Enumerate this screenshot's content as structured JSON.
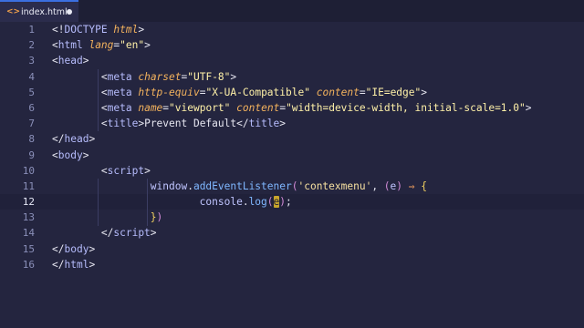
{
  "tab": {
    "filename": "index.html",
    "icon": "<>",
    "modified": true
  },
  "active_line": 12,
  "lines": [
    {
      "num": "1",
      "indent": "",
      "tokens": [
        [
          "t-punct",
          "<!"
        ],
        [
          "t-tag",
          "DOCTYPE"
        ],
        [
          "t-punct",
          " "
        ],
        [
          "t-attr",
          "html"
        ],
        [
          "t-punct",
          ">"
        ]
      ]
    },
    {
      "num": "2",
      "indent": "",
      "tokens": [
        [
          "t-punct",
          "<"
        ],
        [
          "t-tag",
          "html"
        ],
        [
          "t-punct",
          " "
        ],
        [
          "t-attr",
          "lang"
        ],
        [
          "t-punct",
          "="
        ],
        [
          "t-str",
          "\"en\""
        ],
        [
          "t-punct",
          ">"
        ]
      ]
    },
    {
      "num": "3",
      "indent": "",
      "tokens": [
        [
          "t-punct",
          "<"
        ],
        [
          "t-tag",
          "head"
        ],
        [
          "t-punct",
          ">"
        ]
      ]
    },
    {
      "num": "4",
      "indent": "        ",
      "tokens": [
        [
          "t-punct",
          "<"
        ],
        [
          "t-tag",
          "meta"
        ],
        [
          "t-punct",
          " "
        ],
        [
          "t-attr",
          "charset"
        ],
        [
          "t-punct",
          "="
        ],
        [
          "t-str",
          "\"UTF-8\""
        ],
        [
          "t-punct",
          ">"
        ]
      ]
    },
    {
      "num": "5",
      "indent": "        ",
      "tokens": [
        [
          "t-punct",
          "<"
        ],
        [
          "t-tag",
          "meta"
        ],
        [
          "t-punct",
          " "
        ],
        [
          "t-attr",
          "http-equiv"
        ],
        [
          "t-punct",
          "="
        ],
        [
          "t-str",
          "\"X-UA-Compatible\""
        ],
        [
          "t-punct",
          " "
        ],
        [
          "t-attr",
          "content"
        ],
        [
          "t-punct",
          "="
        ],
        [
          "t-str",
          "\"IE=edge\""
        ],
        [
          "t-punct",
          ">"
        ]
      ]
    },
    {
      "num": "6",
      "indent": "        ",
      "tokens": [
        [
          "t-punct",
          "<"
        ],
        [
          "t-tag",
          "meta"
        ],
        [
          "t-punct",
          " "
        ],
        [
          "t-attr",
          "name"
        ],
        [
          "t-punct",
          "="
        ],
        [
          "t-str",
          "\"viewport\""
        ],
        [
          "t-punct",
          " "
        ],
        [
          "t-attr",
          "content"
        ],
        [
          "t-punct",
          "="
        ],
        [
          "t-str",
          "\"width=device-width, initial-scale=1.0\""
        ],
        [
          "t-punct",
          ">"
        ]
      ]
    },
    {
      "num": "7",
      "indent": "        ",
      "tokens": [
        [
          "t-punct",
          "<"
        ],
        [
          "t-tag",
          "title"
        ],
        [
          "t-punct",
          ">"
        ],
        [
          "t-plain",
          "Prevent Default"
        ],
        [
          "t-punct",
          "</"
        ],
        [
          "t-tag",
          "title"
        ],
        [
          "t-punct",
          ">"
        ]
      ]
    },
    {
      "num": "8",
      "indent": "",
      "tokens": [
        [
          "t-punct",
          "</"
        ],
        [
          "t-tag",
          "head"
        ],
        [
          "t-punct",
          ">"
        ]
      ]
    },
    {
      "num": "9",
      "indent": "",
      "tokens": [
        [
          "t-punct",
          "<"
        ],
        [
          "t-tag",
          "body"
        ],
        [
          "t-punct",
          ">"
        ]
      ]
    },
    {
      "num": "10",
      "indent": "        ",
      "tokens": [
        [
          "t-punct",
          "<"
        ],
        [
          "t-tag",
          "script"
        ],
        [
          "t-punct",
          ">"
        ]
      ]
    },
    {
      "num": "11",
      "indent": "                ",
      "tokens": [
        [
          "t-name",
          "window"
        ],
        [
          "t-plain",
          "."
        ],
        [
          "t-fn",
          "addEventListener"
        ],
        [
          "t-paren",
          "("
        ],
        [
          "t-str2",
          "'contexmenu'"
        ],
        [
          "t-plain",
          ", "
        ],
        [
          "t-paren",
          "("
        ],
        [
          "t-name",
          "e"
        ],
        [
          "t-paren",
          ")"
        ],
        [
          "t-plain",
          " "
        ],
        [
          "t-arrow",
          "⇒"
        ],
        [
          "t-plain",
          " "
        ],
        [
          "t-brace",
          "{"
        ]
      ]
    },
    {
      "num": "12",
      "indent": "                        ",
      "tokens": [
        [
          "t-name",
          "console"
        ],
        [
          "t-plain",
          "."
        ],
        [
          "t-fn",
          "log"
        ],
        [
          "t-paren",
          "("
        ],
        [
          "cursor-box",
          "e"
        ],
        [
          "t-paren",
          ")"
        ],
        [
          "t-plain",
          ";"
        ]
      ]
    },
    {
      "num": "13",
      "indent": "                ",
      "tokens": [
        [
          "t-brace",
          "}"
        ],
        [
          "t-paren",
          ")"
        ]
      ]
    },
    {
      "num": "14",
      "indent": "        ",
      "tokens": [
        [
          "t-punct",
          "</"
        ],
        [
          "t-tag",
          "script"
        ],
        [
          "t-punct",
          ">"
        ]
      ]
    },
    {
      "num": "15",
      "indent": "",
      "tokens": [
        [
          "t-punct",
          "</"
        ],
        [
          "t-tag",
          "body"
        ],
        [
          "t-punct",
          ">"
        ]
      ]
    },
    {
      "num": "16",
      "indent": "",
      "tokens": [
        [
          "t-punct",
          "</"
        ],
        [
          "t-tag",
          "html"
        ],
        [
          "t-punct",
          ">"
        ]
      ]
    }
  ]
}
